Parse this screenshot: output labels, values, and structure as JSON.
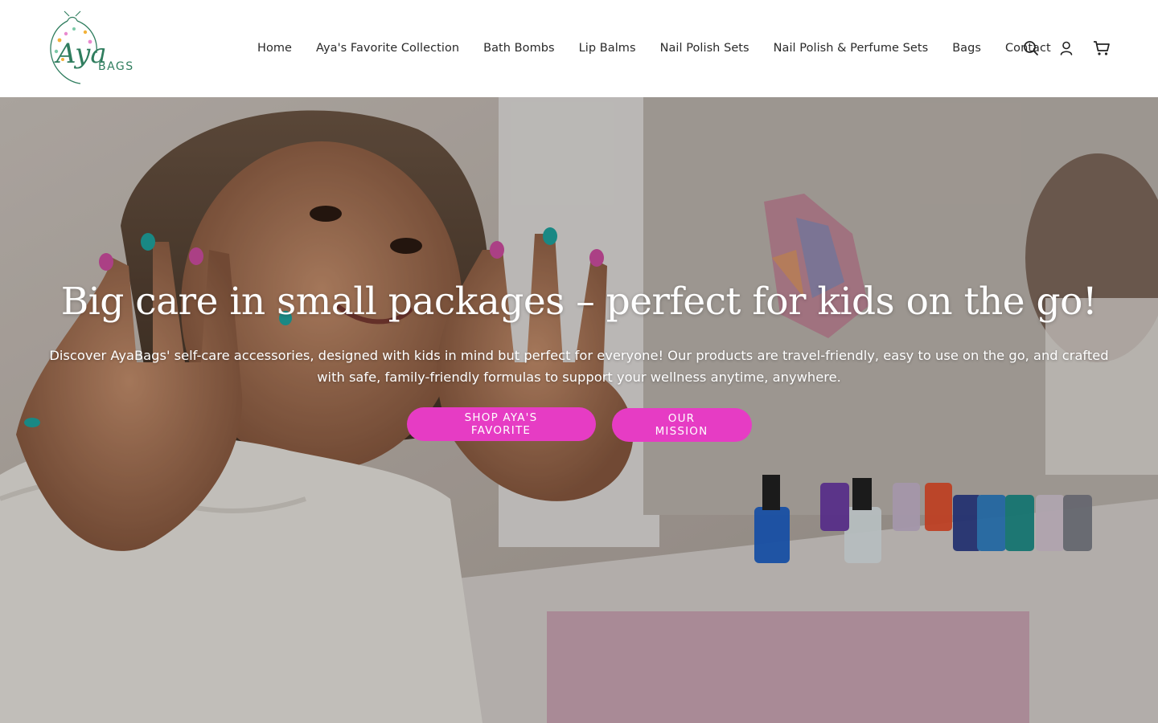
{
  "brand": {
    "logo_script": "Aya",
    "logo_word": "BAGS",
    "colors": {
      "logo_green": "#2f7d5e",
      "accent_pink": "#e63cc4"
    }
  },
  "nav": {
    "items": [
      {
        "label": "Home"
      },
      {
        "label": "Aya's Favorite Collection"
      },
      {
        "label": "Bath Bombs"
      },
      {
        "label": "Lip Balms"
      },
      {
        "label": "Nail Polish Sets"
      },
      {
        "label": "Nail Polish & Perfume Sets"
      },
      {
        "label": "Bags"
      },
      {
        "label": "Contact"
      }
    ]
  },
  "header_icons": {
    "search": "search-icon",
    "account": "account-icon",
    "cart": "cart-icon"
  },
  "hero": {
    "title": "Big care in small packages – perfect for kids on the go!",
    "text": "Discover AyaBags' self-care accessories, designed with kids in mind but perfect for everyone! Our products are travel-friendly, easy to use on the go, and crafted with safe, family-friendly formulas to support your wellness anytime, anywhere.",
    "primary_button": "SHOP AYA'S FAVORITE",
    "secondary_button": "OUR MISSION"
  }
}
